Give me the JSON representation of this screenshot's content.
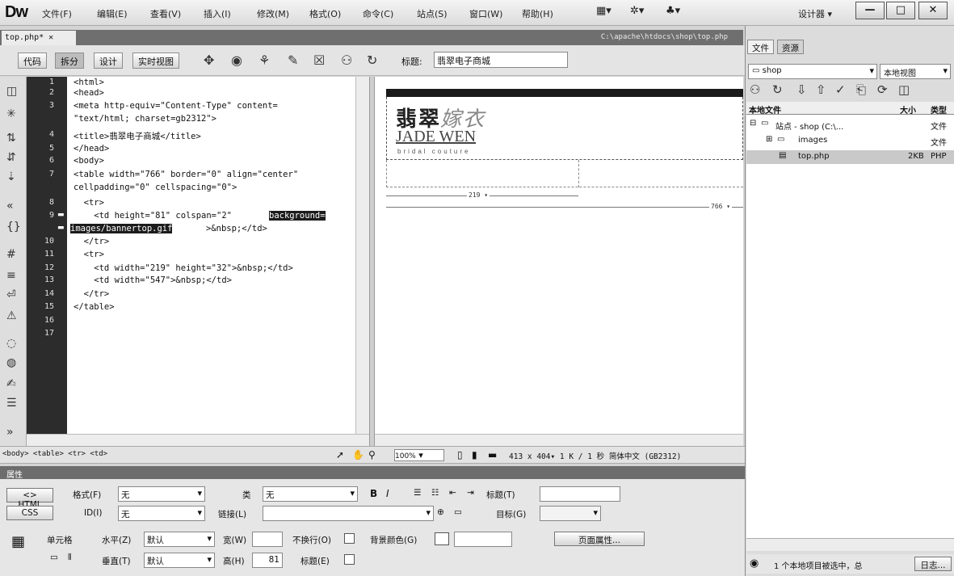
{
  "app": {
    "logo": "Dw",
    "menu": [
      "文件(F)",
      "编辑(E)",
      "查看(V)",
      "插入(I)",
      "修改(M)",
      "格式(O)",
      "命令(C)",
      "站点(S)",
      "窗口(W)",
      "帮助(H)"
    ],
    "workspace": "设计器 ▾",
    "win_min": "—",
    "win_max": "□",
    "win_close": "✕"
  },
  "document": {
    "tab": "top.php* ✕",
    "path": "C:\\apache\\htdocs\\shop\\top.php",
    "toolbar": {
      "code": "代码",
      "split": "拆分",
      "design": "设计",
      "live": "实时视图",
      "title_label": "标题:",
      "title_value": "翡翠电子商城"
    }
  },
  "code": {
    "line_numbers": [
      "1",
      "2",
      "3",
      "",
      "4",
      "5",
      "6",
      "7",
      "",
      "8",
      "9",
      "",
      "10",
      "11",
      "12",
      "13",
      "14",
      "15",
      "16",
      "17"
    ],
    "lines": [
      "<html>",
      "<head>",
      "<meta http-equiv=\"Content-Type\" content=",
      "\"text/html; charset=gb2312\">",
      "<title>翡翠电子商城</title>",
      "</head>",
      "<body>",
      "<table width=\"766\" border=\"0\" align=\"center\"",
      "cellpadding=\"0\" cellspacing=\"0\">",
      "  <tr>",
      "    <td height=\"81\" colspan=\"2\" ",
      "",
      "  </tr>",
      "  <tr>",
      "    <td width=\"219\" height=\"32\">&nbsp;</td>",
      "    <td width=\"547\">&nbsp;</td>",
      "  </tr>",
      "</table>"
    ],
    "hl_a": "background=",
    "hl_b": "images/bannertop.gif",
    "after_hl": ">&nbsp;</td>"
  },
  "design": {
    "brand_cn_1": "翡翠",
    "brand_cn_2": "嫁衣",
    "brand_en": "JADE WEN",
    "brand_sub": "bridal couture",
    "ruler_219": "219 ▾",
    "ruler_766": "766 ▾"
  },
  "status": {
    "tags": "<body> <table> <tr> <td>",
    "zoom": "100%",
    "info": "413 x 404▾ 1 K / 1 秒 简体中文 (GB2312)"
  },
  "properties": {
    "title": "属性",
    "html_btn": "<> HTML",
    "css_btn": "CSS",
    "format_label": "格式(F)",
    "format_value": "无",
    "class_label": "类",
    "class_value": "无",
    "id_label": "ID(I)",
    "id_value": "无",
    "link_label": "链接(L)",
    "link_value": "",
    "bold": "B",
    "italic": "I",
    "heading_label": "标题(T)",
    "target_label": "目标(G)",
    "cell_label": "单元格",
    "horz_label": "水平(Z)",
    "horz_value": "默认",
    "width_label": "宽(W)",
    "nowrap_label": "不换行(O)",
    "bg_label": "背景颜色(G)",
    "vert_label": "垂直(T)",
    "vert_value": "默认",
    "height_label": "高(H)",
    "height_value": "81",
    "header_label": "标题(E)",
    "page_props": "页面属性..."
  },
  "files": {
    "tab_files": "文件",
    "tab_assets": "资源",
    "site": "shop",
    "view": "本地视图",
    "col_local": "本地文件",
    "col_size": "大小",
    "col_type": "类型",
    "rows": [
      {
        "name": "站点 - shop (C:\\...",
        "size": "",
        "type": "文件"
      },
      {
        "name": "images",
        "size": "",
        "type": "文件"
      },
      {
        "name": "top.php",
        "size": "2KB",
        "type": "PHP"
      }
    ],
    "status": "1 个本地项目被选中，总",
    "log_btn": "日志..."
  }
}
